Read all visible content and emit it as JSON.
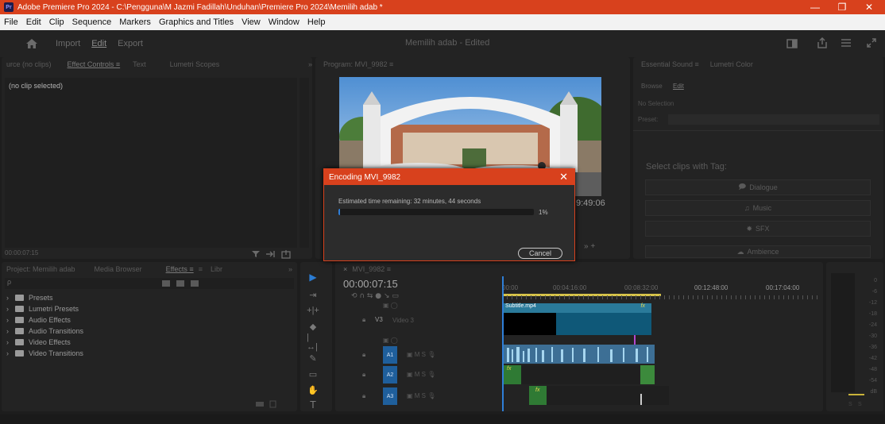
{
  "window": {
    "title": "Adobe Premiere Pro 2024 - C:\\Pengguna\\M Jazmi Fadillah\\Unduhan\\Premiere Pro 2024\\Memilih adab *",
    "logo": "Pr",
    "minimize": "—",
    "maximize": "❐",
    "close": "✕"
  },
  "menu": [
    "File",
    "Edit",
    "Clip",
    "Sequence",
    "Markers",
    "Graphics and Titles",
    "View",
    "Window",
    "Help"
  ],
  "header": {
    "home_icon": "home-icon",
    "tabs": [
      "Import",
      "Edit",
      "Export"
    ],
    "project_title": "Memilih adab - Edited"
  },
  "source_panel": {
    "tabs": [
      "urce (no clips)",
      "Effect Controls ≡",
      "Text",
      "Lumetri Scopes"
    ],
    "overflow": "»",
    "no_clip": "(no clip selected)",
    "timecode": "00:00:07:15"
  },
  "program": {
    "tab": "Program: MVI_9982 ≡",
    "timecode": "9:49:06"
  },
  "project_panel": {
    "tabs": [
      "Project: Memilih adab",
      "Media Browser",
      "Effects ≡",
      "Libr"
    ],
    "overflow": "»",
    "search_icon": "ρ",
    "items": [
      "Presets",
      "Lumetri Presets",
      "Audio Effects",
      "Audio Transitions",
      "Video Effects",
      "Video Transitions"
    ]
  },
  "essential": {
    "tabs": [
      "Essential Sound ≡",
      "Lumetri Color"
    ],
    "subtabs": [
      "Browse",
      "Edit"
    ],
    "no_selection": "No Selection",
    "preset_label": "Preset:",
    "prompt": "Select clips with Tag:",
    "tags": [
      "Dialogue",
      "Music",
      "SFX",
      "Ambience"
    ]
  },
  "timeline": {
    "tab": "MVI_9982 ≡",
    "close": "×",
    "timecode": "00:00:07:15",
    "ruler": [
      "00:00",
      "00:04:16:00",
      "00:08:32:00",
      "00:12:48:00",
      "00:17:04:00"
    ],
    "tracks": {
      "v3": "V3",
      "video_name": "Video 3",
      "a1": "A1",
      "a2": "A2",
      "a3": "A3"
    },
    "clip": "Subtitle.mp4",
    "fx": "fx"
  },
  "meter": {
    "ticks": [
      "0",
      "-6",
      "-12",
      "-18",
      "-24",
      "-30",
      "-36",
      "-42",
      "-48",
      "-54",
      "dB"
    ],
    "solo": "S",
    "solo2": "S"
  },
  "dialog": {
    "title": "Encoding MVI_9982",
    "close": "✕",
    "message": "Estimated time remaining: 32 minutes, 44 seconds",
    "percent": "1%",
    "progress": 0.01,
    "cancel": "Cancel"
  },
  "colors": {
    "accent": "#d8411d",
    "clip_blue": "#2a7a9a"
  }
}
